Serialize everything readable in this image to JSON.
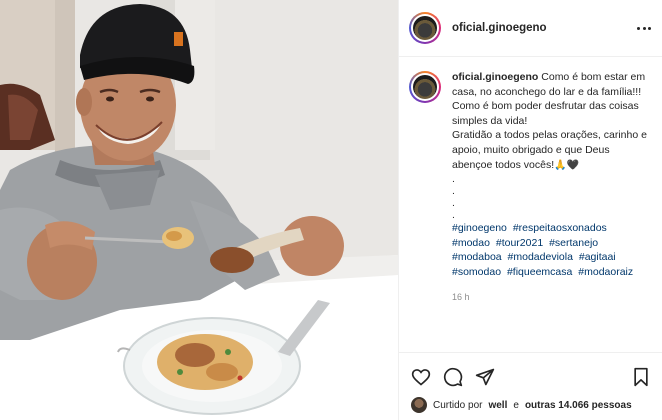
{
  "post": {
    "username": "oficial.ginoegeno",
    "more_icon": "more-horizontal-icon"
  },
  "caption": {
    "username": "oficial.ginoegeno",
    "lines": [
      "Como é bom estar em casa, no aconchego do lar e da família!!!",
      "Como é bom poder desfrutar das coisas simples da vida!",
      "Gratidão a todos pelas orações, carinho e apoio, muito obrigado e que Deus abençoe todos vocês!"
    ],
    "emojis": [
      "🙏",
      "🖤"
    ],
    "dots": [
      ".",
      ".",
      ".",
      "."
    ],
    "hashtags": [
      "#ginoegeno",
      "#respeitaosxonados",
      "#modao",
      "#tour2021",
      "#sertanejo",
      "#modaboa",
      "#modadeviola",
      "#agitaai",
      "#somodao",
      "#fiqueemcasa",
      "#modaoraiz"
    ],
    "time": "16 h"
  },
  "actions": {
    "icons": [
      "heart-icon",
      "comment-icon",
      "share-icon",
      "bookmark-icon"
    ]
  },
  "likes": {
    "prefix": "Curtido por",
    "user": "well",
    "conjunction": "e",
    "others": "outras 14.066 pessoas"
  },
  "colors": {
    "hashtag": "#00376b",
    "text": "#262626",
    "muted": "#8e8e8e",
    "border": "#efefef"
  }
}
